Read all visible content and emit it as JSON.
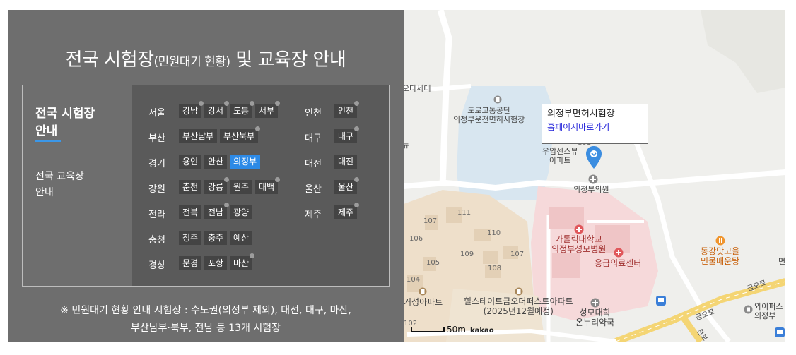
{
  "panel": {
    "title_main": "전국 시험장",
    "title_sub": "(민원대기 현황)",
    "title_rest": " 및 교육장 안내",
    "menu": {
      "active_line1": "전국 시험장",
      "active_line2": "안내",
      "inactive_line1": "전국 교육장",
      "inactive_line2": "안내"
    },
    "regions_left": [
      {
        "name": "서울",
        "sites": [
          "강남",
          "강서",
          "도봉",
          "서부"
        ]
      },
      {
        "name": "부산",
        "sites": [
          "부산남부",
          "부산북부"
        ]
      },
      {
        "name": "경기",
        "sites": [
          "용인",
          "안산",
          "의정부"
        ]
      },
      {
        "name": "강원",
        "sites": [
          "춘천",
          "강릉",
          "원주",
          "태백"
        ]
      },
      {
        "name": "전라",
        "sites": [
          "전북",
          "전남",
          "광양"
        ]
      },
      {
        "name": "충청",
        "sites": [
          "청주",
          "충주",
          "예산"
        ]
      },
      {
        "name": "경상",
        "sites": [
          "문경",
          "포항",
          "마산"
        ]
      }
    ],
    "regions_right": [
      {
        "name": "인천",
        "sites": [
          "인천"
        ]
      },
      {
        "name": "대구",
        "sites": [
          "대구"
        ]
      },
      {
        "name": "대전",
        "sites": [
          "대전"
        ]
      },
      {
        "name": "울산",
        "sites": [
          "울산"
        ]
      },
      {
        "name": "제주",
        "sites": [
          "제주"
        ]
      }
    ],
    "selected_site": "의정부",
    "notice_line1": "※ 민원대기 현황 안내 시험장 : 수도권(의정부 제외), 대전, 대구, 마산,",
    "notice_line2": "부산남부·북부, 전남 등 13개 시험장"
  },
  "map": {
    "callout_title": "의정부면허시험장",
    "callout_link": "홈페이지바로가기",
    "labels": {
      "odaseda": "오다세대",
      "koroad_1": "도로교통공단",
      "koroad_2": "의정부운전면허시험장",
      "woosam_1": "우암센스뷰",
      "woosam_2": "아파트",
      "clinic": "의정부의원",
      "catholic_1": "가톨릭대학교",
      "catholic_2": "의정부성모병원",
      "emergency": "응급의료센터",
      "donggang_1": "동강맛고을",
      "donggang_2": "민물매운탕",
      "geoseong": "거성아파트",
      "hillstate_1": "힐스테이트금오더퍼스트아파트",
      "hillstate_2": "(2025년12월예정)",
      "pharmacy_1": "성모대학",
      "pharmacy_2": "온누리약국",
      "wise_1": "와이퍼스",
      "wise_2": "의정부",
      "road_1": "금오로",
      "road_2": "금오로",
      "road_3": "천보",
      "edge_1": "면",
      "edge_2": "뉴",
      "b111": "111",
      "b107a": "107",
      "b106": "106",
      "b110": "110",
      "b109": "109",
      "b107b": "107",
      "b105": "105",
      "b108": "108",
      "b104": "104",
      "b102": "102",
      "b101": "101"
    },
    "scale_label": "50m",
    "provider": "kakao",
    "colors": {
      "water": "#d8e6f0",
      "hospital": "#f7dada",
      "apartment": "#efe0cc",
      "pin": "#3b8de0"
    }
  }
}
